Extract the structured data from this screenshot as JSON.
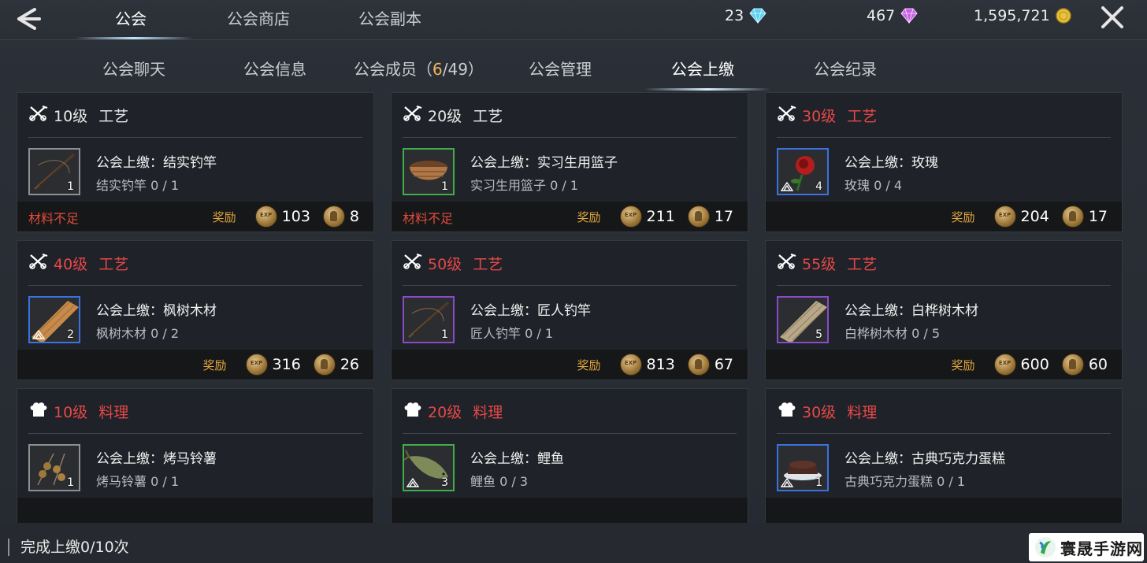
{
  "header": {
    "tabs": [
      "公会",
      "公会商店",
      "公会副本"
    ],
    "active_tab": 0,
    "currencies": [
      {
        "value": "23",
        "icon": "blue-diamond-icon"
      },
      {
        "value": "467",
        "icon": "purple-diamond-icon"
      },
      {
        "value": "1,595,721",
        "icon": "gold-coin-icon"
      }
    ]
  },
  "subtabs": {
    "chat": "公会聊天",
    "info": "公会信息",
    "members_label": "公会成员（",
    "members_current": "6",
    "members_total": "/49）",
    "manage": "公会管理",
    "tribute": "公会上缴",
    "record": "公会纪录",
    "active": "公会上缴"
  },
  "cards": [
    {
      "icon": "crafting-icon",
      "level": "10级",
      "skill": "工艺",
      "red": false,
      "task": "公会上缴：结实钓竿",
      "progress": "结实钓竿 0 / 1",
      "qty": "1",
      "frame": "gray",
      "item_icon": "fishing-rod-icon",
      "shortage": "材料不足",
      "reward_label": "奖励",
      "exp": "103",
      "contrib": "8"
    },
    {
      "icon": "crafting-icon",
      "level": "20级",
      "skill": "工艺",
      "red": false,
      "task": "公会上缴：实习生用篮子",
      "progress": "实习生用篮子 0 / 1",
      "qty": "1",
      "frame": "green",
      "item_icon": "basket-icon",
      "shortage": "材料不足",
      "reward_label": "奖励",
      "exp": "211",
      "contrib": "17"
    },
    {
      "icon": "crafting-icon",
      "level": "30级",
      "skill": "工艺",
      "red": true,
      "task": "公会上缴：玫瑰",
      "progress": "玫瑰 0 / 4",
      "qty": "4",
      "frame": "blue",
      "item_icon": "rose-icon",
      "shortage": "",
      "reward_label": "奖励",
      "exp": "204",
      "contrib": "17"
    },
    {
      "icon": "crafting-icon",
      "level": "40级",
      "skill": "工艺",
      "red": true,
      "task": "公会上缴：枫树木材",
      "progress": "枫树木材 0 / 2",
      "qty": "2",
      "frame": "blue",
      "item_icon": "maple-lumber-icon",
      "shortage": "",
      "reward_label": "奖励",
      "exp": "316",
      "contrib": "26"
    },
    {
      "icon": "crafting-icon",
      "level": "50级",
      "skill": "工艺",
      "red": true,
      "task": "公会上缴：匠人钓竿",
      "progress": "匠人钓竿 0 / 1",
      "qty": "1",
      "frame": "purple",
      "item_icon": "fishing-rod-icon",
      "shortage": "",
      "reward_label": "奖励",
      "exp": "813",
      "contrib": "67"
    },
    {
      "icon": "crafting-icon",
      "level": "55级",
      "skill": "工艺",
      "red": true,
      "task": "公会上缴：白桦树木材",
      "progress": "白桦树木材 0 / 5",
      "qty": "5",
      "frame": "purple",
      "item_icon": "birch-lumber-icon",
      "shortage": "",
      "reward_label": "奖励",
      "exp": "600",
      "contrib": "60"
    },
    {
      "icon": "chef-hat-icon",
      "level": "10级",
      "skill": "料理",
      "red": true,
      "task": "公会上缴：烤马铃薯",
      "progress": "烤马铃薯 0 / 1",
      "qty": "1",
      "frame": "gray",
      "item_icon": "roasted-potato-icon",
      "shortage": "",
      "reward_label": "",
      "exp": "",
      "contrib": ""
    },
    {
      "icon": "chef-hat-icon",
      "level": "20级",
      "skill": "料理",
      "red": true,
      "task": "公会上缴：鲤鱼",
      "progress": "鲤鱼 0 / 3",
      "qty": "3",
      "frame": "green",
      "item_icon": "carp-icon",
      "shortage": "",
      "reward_label": "",
      "exp": "",
      "contrib": ""
    },
    {
      "icon": "chef-hat-icon",
      "level": "30级",
      "skill": "料理",
      "red": true,
      "task": "公会上缴：古典巧克力蛋糕",
      "progress": "古典巧克力蛋糕 0 / 1",
      "qty": "1",
      "frame": "blue",
      "item_icon": "chocolate-cake-icon",
      "shortage": "",
      "reward_label": "",
      "exp": "",
      "contrib": ""
    }
  ],
  "footer": {
    "completion": "完成上缴0/10次"
  },
  "watermark": {
    "text": "寰晟手游网"
  }
}
